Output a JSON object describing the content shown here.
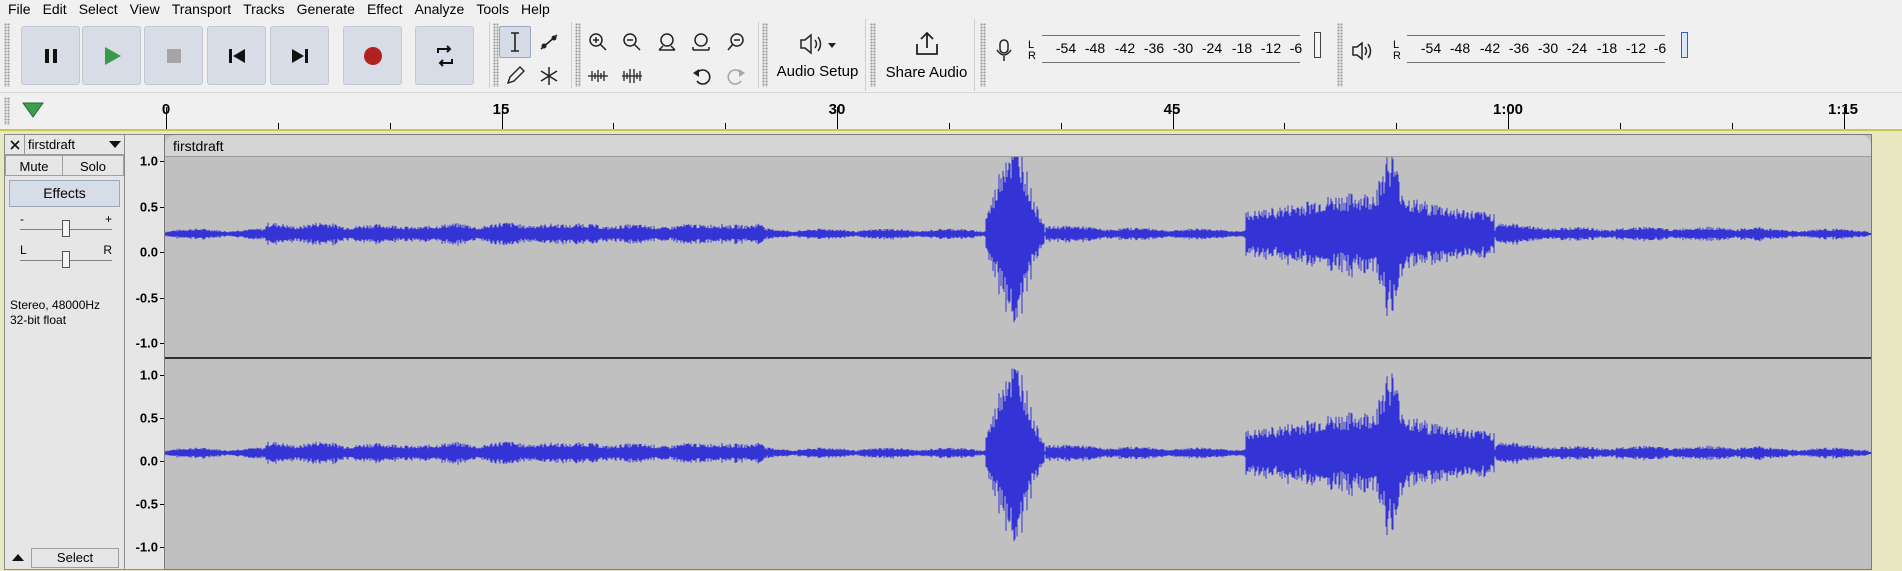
{
  "menu": [
    "File",
    "Edit",
    "Select",
    "View",
    "Transport",
    "Tracks",
    "Generate",
    "Effect",
    "Analyze",
    "Tools",
    "Help"
  ],
  "toolbar": {
    "audio_setup_label": "Audio Setup",
    "share_audio_label": "Share Audio",
    "meter_scale": [
      "-54",
      "-48",
      "-42",
      "-36",
      "-30",
      "-24",
      "-18",
      "-12",
      "-6"
    ],
    "meter_l": "L",
    "meter_r": "R"
  },
  "timeline": {
    "labels": [
      "0",
      "15",
      "30",
      "45",
      "1:00",
      "1:15"
    ]
  },
  "track": {
    "name": "firstdraft",
    "mute_label": "Mute",
    "solo_label": "Solo",
    "effects_label": "Effects",
    "pan_left": "L",
    "pan_right": "R",
    "format_line1": "Stereo, 48000Hz",
    "format_line2": "32-bit float",
    "select_label": "Select",
    "clip_name": "firstdraft",
    "vruler_labels": [
      "1.0",
      "0.5",
      "0.0",
      "-0.5",
      "-1.0"
    ]
  },
  "colors": {
    "waveform": "#3434d6",
    "waveform_rms": "#6464e8",
    "clip_bg": "#c0c0c0",
    "track_border": "#c8c850"
  },
  "icons": {
    "pause": "pause-icon",
    "play": "play-icon",
    "stop": "stop-icon",
    "skip_start": "skip-to-start-icon",
    "skip_end": "skip-to-end-icon",
    "record": "record-icon",
    "loop": "loop-icon",
    "select_tool": "i-beam-icon",
    "envelope_tool": "envelope-icon",
    "draw_tool": "pencil-icon",
    "multi_tool": "asterisk-icon",
    "zoom_in": "zoom-in-icon",
    "zoom_out": "zoom-out-icon",
    "fit_selection": "fit-selection-icon",
    "fit_project": "fit-project-icon",
    "zoom_toggle": "zoom-toggle-icon",
    "trim": "trim-icon",
    "silence": "silence-icon",
    "undo": "undo-icon",
    "redo": "redo-icon",
    "audio_setup": "speaker-icon",
    "share_audio": "share-icon",
    "mic": "microphone-icon",
    "speaker": "speaker-meter-icon",
    "timeline_play": "play-head-triangle-icon",
    "close": "close-icon",
    "menu_arrow": "triangle-down-icon",
    "collapse": "collapse-icon"
  }
}
